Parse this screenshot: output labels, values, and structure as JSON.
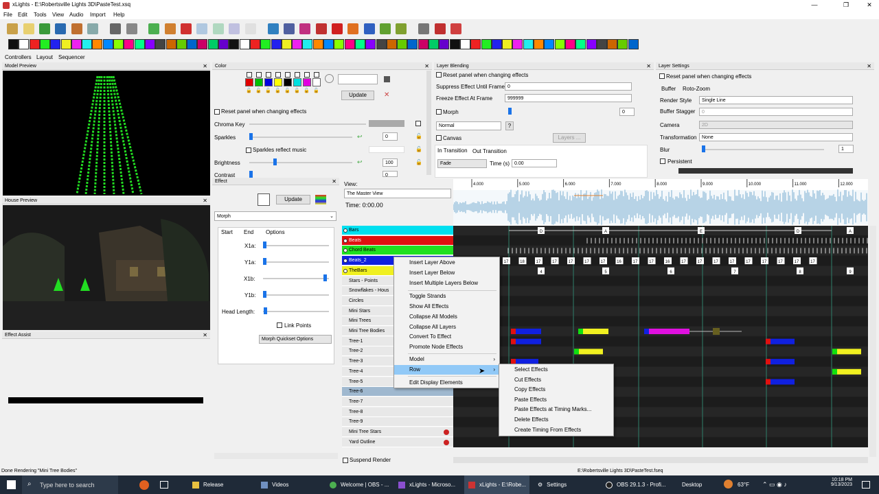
{
  "window": {
    "title": "xLights - E:\\Robertsville Lights 3D\\PasteTest.xsq",
    "minimize": "—",
    "maximize": "❐",
    "close": "✕"
  },
  "menu": [
    "File",
    "Edit",
    "Tools",
    "View",
    "Audio",
    "Import",
    "Help"
  ],
  "main_tabs": [
    "Controllers",
    "Layout",
    "Sequencer"
  ],
  "panels": {
    "model_preview": "Model Preview",
    "house_preview": "House Preview",
    "effect_assist": "Effect Assist",
    "color": "Color",
    "effect": "Effect",
    "layer_blending": "Layer Blending",
    "layer_settings": "Layer Settings"
  },
  "color_panel": {
    "update": "Update",
    "reset_panel": "Reset panel when changing effects",
    "chroma_key": "Chroma Key",
    "sparkles": "Sparkles",
    "sparkles_value": "0",
    "sparkles_reflect": "Sparkles reflect music",
    "brightness": "Brightness",
    "brightness_value": "100",
    "contrast": "Contrast",
    "contrast_value": "0",
    "palette": [
      "#e00000",
      "#00c000",
      "#0000e0",
      "#ffff00",
      "#000000",
      "#00e0e0",
      "#e000e0",
      "#ffffff"
    ]
  },
  "effect_panel": {
    "update": "Update",
    "effect_name": "Morph",
    "tabs": [
      "Start",
      "End",
      "Options"
    ],
    "x1a": "X1a:",
    "y1a": "Y1a:",
    "x1b": "X1b:",
    "y1b": "Y1b:",
    "head_length": "Head Length:",
    "link_points": "Link Points",
    "quickset": "Morph Quickset Options"
  },
  "layer_blending": {
    "reset": "Reset panel when changing effects",
    "suppress": "Suppress Effect Until Frame",
    "suppress_value": "0",
    "freeze": "Freeze Effect At Frame",
    "freeze_value": "999999",
    "morph": "Morph",
    "morph_value": "0",
    "blend_mode": "Normal",
    "help": "?",
    "canvas": "Canvas",
    "layers": "Layers ...",
    "in_transition": "In Transition",
    "out_transition": "Out Transition",
    "transition_type": "Fade",
    "time_label": "Time (s)",
    "time_value": "0.00"
  },
  "layer_settings": {
    "reset": "Reset panel when changing effects",
    "tabs": [
      "Buffer",
      "Roto-Zoom"
    ],
    "render_style": "Render Style",
    "render_style_value": "Single Line",
    "buffer_stagger": "Buffer Stagger",
    "buffer_stagger_value": "0",
    "camera": "Camera",
    "camera_value": "2D",
    "transformation": "Transformation",
    "transformation_value": "None",
    "blur": "Blur",
    "blur_value": "1",
    "persistent": "Persistent"
  },
  "sequencer": {
    "view_label": "View:",
    "view_value": "The Master View",
    "time_label": "Time: 0:00.00",
    "time_ticks": [
      "4.000",
      "5.000",
      "6.000",
      "7.000",
      "8.000",
      "9.000",
      "10.000",
      "11.000",
      "12.000"
    ],
    "rows": [
      {
        "label": "Bars",
        "color": "#00e0f0"
      },
      {
        "label": "Beats",
        "color": "#e01010"
      },
      {
        "label": "Chord Beats",
        "color": "#20e020"
      },
      {
        "label": "Beats_2",
        "color": "#1020e0"
      },
      {
        "label": "TheBars",
        "color": "#f0f020"
      },
      {
        "label": "Stars - Points",
        "color": ""
      },
      {
        "label": "Snowflakes - Hous",
        "color": ""
      },
      {
        "label": "Circles",
        "color": ""
      },
      {
        "label": "Mini Stars",
        "color": ""
      },
      {
        "label": "Mini Trees",
        "color": ""
      },
      {
        "label": "Mini Tree Bodies",
        "color": ""
      },
      {
        "label": "Tree-1",
        "color": ""
      },
      {
        "label": "Tree-2",
        "color": ""
      },
      {
        "label": "Tree-3",
        "color": ""
      },
      {
        "label": "Tree-4",
        "color": ""
      },
      {
        "label": "Tree-5",
        "color": ""
      },
      {
        "label": "Tree-6",
        "color": ""
      },
      {
        "label": "Tree-7",
        "color": ""
      },
      {
        "label": "Tree-8",
        "color": ""
      },
      {
        "label": "Tree-9",
        "color": ""
      },
      {
        "label": "Mini Tree Stars",
        "color": ""
      },
      {
        "label": "Yard Outline",
        "color": ""
      }
    ],
    "bar_marks": [
      "D",
      "A",
      "E",
      "D",
      "A"
    ],
    "beat_marks": [
      "4",
      "5",
      "6",
      "7",
      "8",
      "9"
    ],
    "chord_marks": [
      "17",
      "18",
      "17",
      "17",
      "17",
      "17",
      "17",
      "16",
      "17",
      "17",
      "16",
      "17",
      "17",
      "17",
      "17",
      "17",
      "17",
      "17",
      "17",
      "17"
    ],
    "suspend_render": "Suspend Render"
  },
  "context_menu": {
    "items": [
      "Insert Layer Above",
      "Insert Layer Below",
      "Insert Multiple Layers Below",
      "Toggle Strands",
      "Show All Effects",
      "Collapse All Models",
      "Collapse All Layers",
      "Convert To Effect",
      "Promote Node Effects",
      "Model",
      "Row",
      "Edit Display Elements"
    ],
    "submenu": [
      "Select Effects",
      "Cut Effects",
      "Copy Effects",
      "Paste Effects",
      "Paste Effects at Timing Marks...",
      "Delete Effects",
      "Create Timing From Effects"
    ]
  },
  "status": {
    "left": "Done Rendering \"Mini Tree Bodies\"",
    "right": "E:\\Robertsville Lights 3D\\PasteTest.fseq"
  },
  "taskbar": {
    "search": "Type here to search",
    "apps": [
      "Release",
      "Videos",
      "Welcome | OBS - ...",
      "xLights - Microso...",
      "xLights - E:\\Robe...",
      "Settings",
      "OBS 29.1.3 - Profi...",
      "Desktop"
    ],
    "weather": "63°F",
    "time": "10:18 PM",
    "date": "9/13/2023"
  }
}
